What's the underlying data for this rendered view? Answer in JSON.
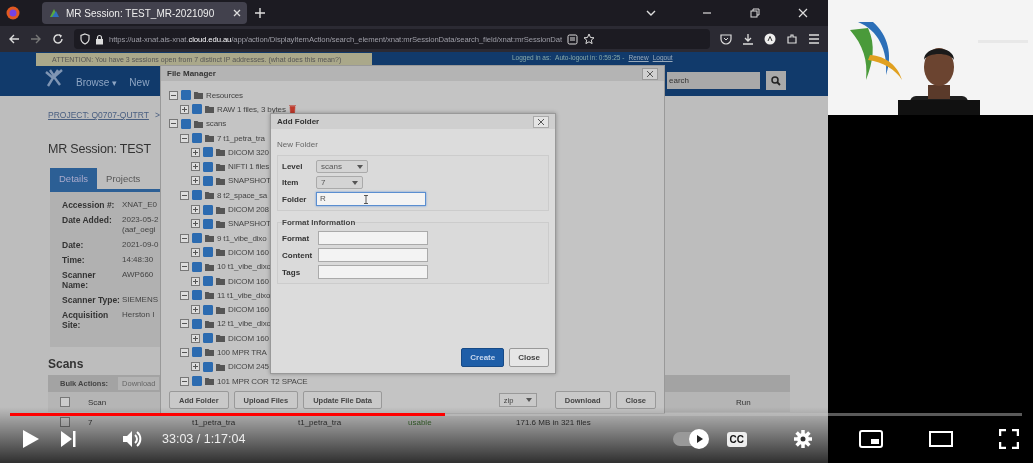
{
  "browser": {
    "tab_title": "MR Session: TEST_MR-2021090",
    "url": "https://uat-xnat.ais-xnat.**cloud.edu.au**/app/action/DisplayItemAction/search_element/xnat:mrSessionData/search_field/xnat:mrSessionDat"
  },
  "site": {
    "attention": "ATTENTION: You have 3 sessions open from 7 distinct IP addresses. (what does this mean?)",
    "session_info": {
      "logged_in": "Logged in as:",
      "autologout": "Auto-logout in: 0:59:25 -",
      "renew": "Renew",
      "logout": "Logout"
    },
    "nav": [
      {
        "label": "Browse",
        "caret": "▾"
      },
      {
        "label": "New"
      }
    ],
    "search_placeholder": "earch",
    "breadcrumb": "PROJECT: Q0707-QUTRT",
    "breadcrumb_sep": ">",
    "title": "MR Session: TEST",
    "tabs": [
      {
        "label": "Details",
        "selected": true
      },
      {
        "label": "Projects",
        "selected": false
      }
    ],
    "details": [
      {
        "label": "Accession #:",
        "values": [
          "XNAT_E0"
        ]
      },
      {
        "label": "Date Added:",
        "values": [
          "2023-05-2",
          "(aaf_oegi"
        ]
      },
      {
        "label": "Date:",
        "values": [
          "2021-09-0"
        ]
      },
      {
        "label": "Time:",
        "values": [
          "14:48:30"
        ]
      },
      {
        "label": "Scanner Name:",
        "values": [
          "AWP660"
        ]
      },
      {
        "label": "Scanner Type:",
        "values": [
          "SIEMENS"
        ]
      },
      {
        "label": "Acquisition Site:",
        "values": [
          "Herston I"
        ]
      }
    ],
    "scans": {
      "title": "Scans",
      "bulk_label": "Bulk Actions:",
      "bulk_action": "Download",
      "columns": [
        "Scan",
        "Run"
      ],
      "header_checked": false,
      "row": {
        "checked": false,
        "cells": [
          "7",
          "t1_petra_tra",
          "t1_petra_tra",
          "usable",
          "171.6 MB in 321 files"
        ]
      }
    }
  },
  "file_manager": {
    "title": "File Manager",
    "tree": [
      {
        "label": "Resources",
        "checked": true,
        "expanded": true,
        "children": [
          {
            "label": "RAW  1 files, 3 bytes",
            "checked": true,
            "expanded": false,
            "deletable": true
          }
        ]
      },
      {
        "label": "scans",
        "checked": true,
        "expanded": true,
        "children": [
          {
            "label": "7 t1_petra_tra",
            "checked": true,
            "expanded": true,
            "children": [
              {
                "label": "DICOM 320",
                "checked": true,
                "expanded": false
              },
              {
                "label": "NIFTI 1 files",
                "checked": true,
                "expanded": false
              },
              {
                "label": "SNAPSHOT",
                "checked": true,
                "expanded": false
              }
            ]
          },
          {
            "label": "8 t2_space_sa",
            "checked": true,
            "expanded": true,
            "children": [
              {
                "label": "DICOM 208",
                "checked": true,
                "expanded": false
              },
              {
                "label": "SNAPSHOT",
                "checked": true,
                "expanded": false
              }
            ]
          },
          {
            "label": "9 t1_vibe_dixo",
            "checked": true,
            "expanded": true,
            "children": [
              {
                "label": "DICOM 160",
                "checked": true,
                "expanded": false
              }
            ]
          },
          {
            "label": "10 t1_vibe_dixo",
            "checked": true,
            "expanded": true,
            "children": [
              {
                "label": "DICOM 160",
                "checked": true,
                "expanded": false
              }
            ]
          },
          {
            "label": "11 t1_vibe_dixo",
            "checked": true,
            "expanded": true,
            "children": [
              {
                "label": "DICOM 160",
                "checked": true,
                "expanded": false
              }
            ]
          },
          {
            "label": "12 t1_vibe_dixo",
            "checked": true,
            "expanded": true,
            "children": [
              {
                "label": "DICOM 160",
                "checked": true,
                "expanded": false
              }
            ]
          },
          {
            "label": "100 MPR TRA",
            "checked": true,
            "expanded": true,
            "children": [
              {
                "label": "DICOM 245",
                "checked": true,
                "expanded": false
              }
            ]
          },
          {
            "label": "101 MPR COR T2 SPACE",
            "checked": true,
            "expanded": true
          }
        ]
      }
    ],
    "buttons_left": [
      "Add Folder",
      "Upload Files",
      "Update File Data"
    ],
    "format": "zip",
    "buttons_right": [
      "Download",
      "Close"
    ]
  },
  "add_folder": {
    "title": "Add Folder",
    "subtitle": "New Folder",
    "location": [
      {
        "label": "Level",
        "kind": "select",
        "value": "scans"
      },
      {
        "label": "Item",
        "kind": "select",
        "value": "7"
      },
      {
        "label": "Folder",
        "kind": "input",
        "value": "R",
        "focused": true
      }
    ],
    "format_title": "Format Information",
    "format_fields": [
      {
        "label": "Format"
      },
      {
        "label": "Content"
      },
      {
        "label": "Tags"
      }
    ],
    "buttons": [
      {
        "label": "Create",
        "primary": true
      },
      {
        "label": "Close",
        "primary": false
      }
    ]
  },
  "player": {
    "time": "33:03 / 1:17:04",
    "progress": {
      "level": 0.43
    },
    "autoplay": {
      "on": true
    },
    "captions": "CC"
  }
}
